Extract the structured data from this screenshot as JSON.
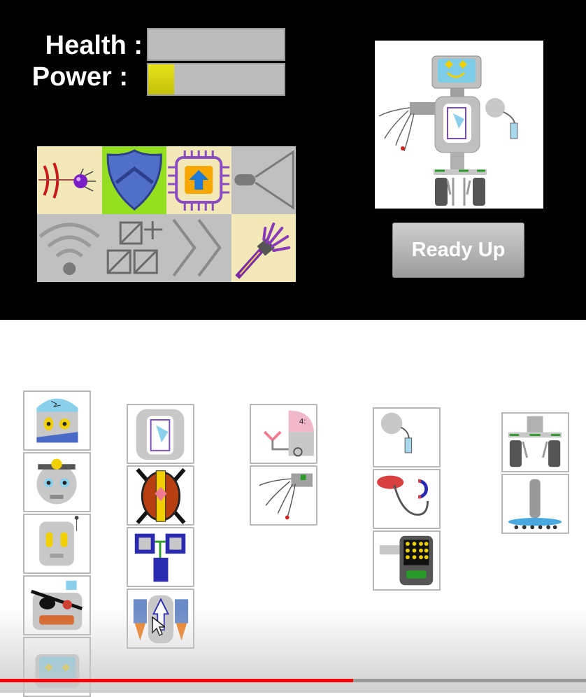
{
  "hud": {
    "health_label": "Health :",
    "power_label": "Power :",
    "health_fraction": 0.0,
    "power_fraction": 0.19
  },
  "abilities": [
    {
      "name": "laser-bug",
      "bg": "#f3e8b8",
      "icon": "bug-laser-icon"
    },
    {
      "name": "shield",
      "bg": "#94e020",
      "icon": "shield-icon"
    },
    {
      "name": "chip-upgrade",
      "bg": "#f3e8b8",
      "icon": "chip-upgrade-icon"
    },
    {
      "name": "megaphone",
      "bg": "#c0c0c0",
      "icon": "megaphone-icon"
    },
    {
      "name": "wifi",
      "bg": "#c0c0c0",
      "icon": "wifi-icon"
    },
    {
      "name": "add-block",
      "bg": "#c0c0c0",
      "icon": "add-block-icon"
    },
    {
      "name": "speed",
      "bg": "#c0c0c0",
      "icon": "chevrons-icon"
    },
    {
      "name": "robot-arm",
      "bg": "#f3e8b8",
      "icon": "robot-arm-icon"
    }
  ],
  "ready_button": {
    "label": "Ready Up"
  },
  "video": {
    "progress_fraction": 0.603
  }
}
